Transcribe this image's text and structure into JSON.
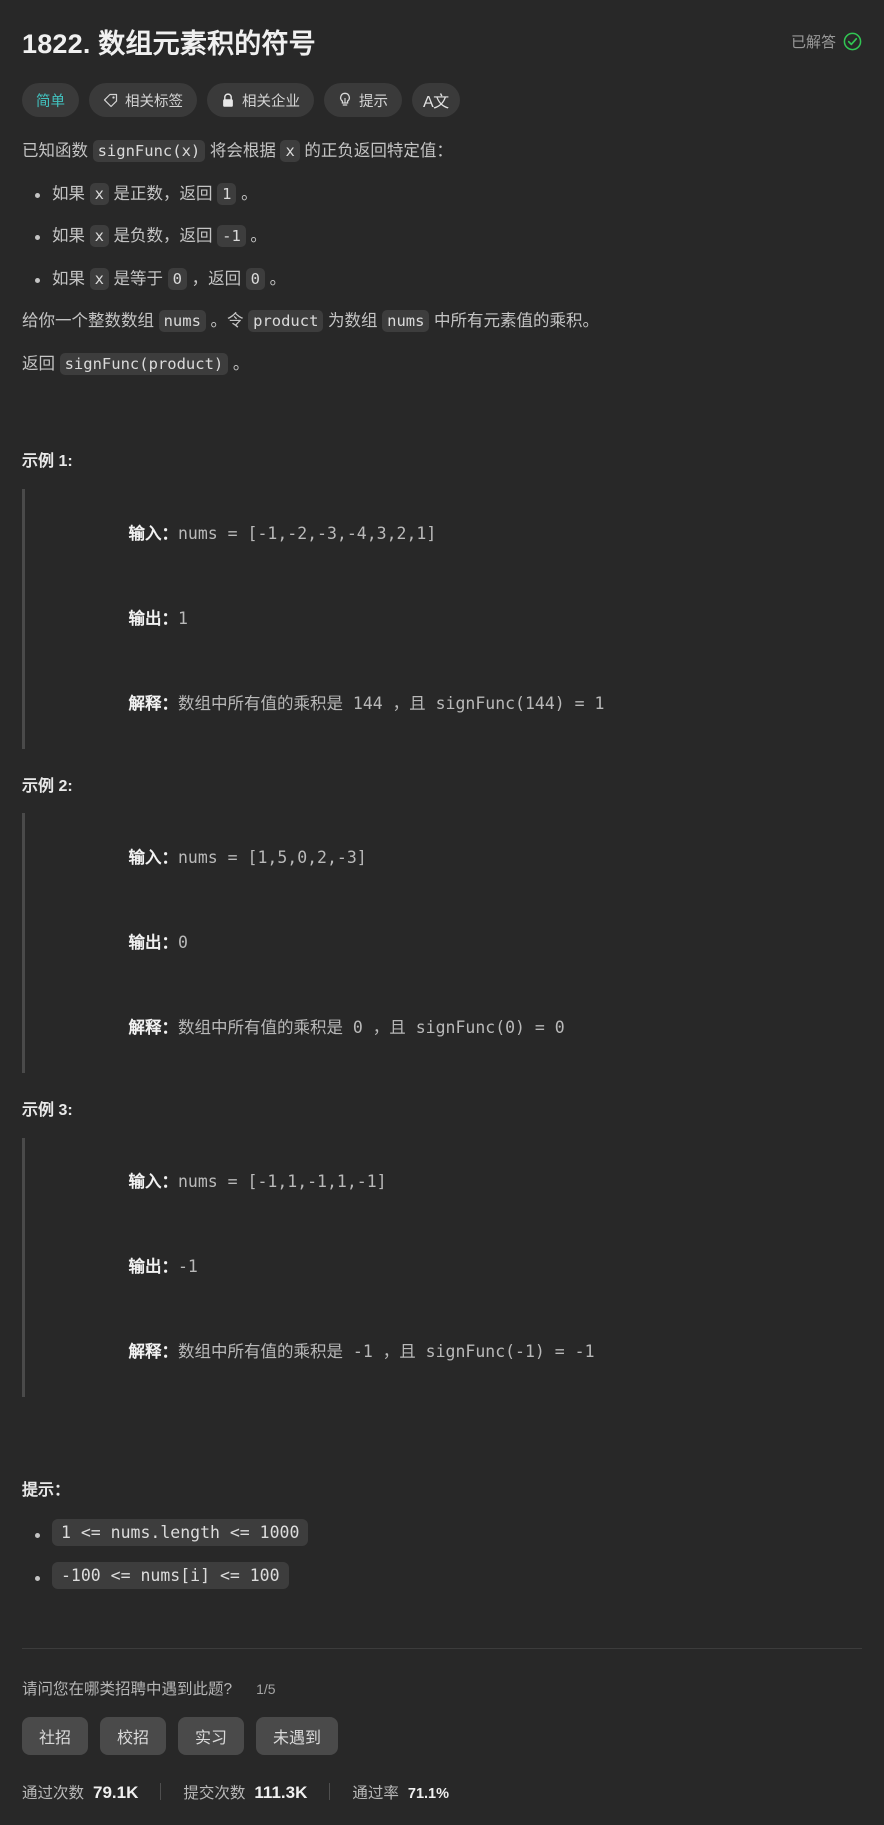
{
  "header": {
    "title": "1822. 数组元素积的符号",
    "solved_label": "已解答",
    "solved_color": "#31c653",
    "badges": [
      {
        "label": "简单",
        "icon": "",
        "accent": "#42c3c0"
      },
      {
        "label": "相关标签",
        "icon": "tag-icon"
      },
      {
        "label": "相关企业",
        "icon": "lock-icon"
      },
      {
        "label": "提示",
        "icon": "lightbulb-icon"
      },
      {
        "label": "A文",
        "icon": "translate-icon"
      }
    ]
  },
  "description": {
    "intro_1": "已知函数",
    "intro_code_1": "signFunc(x)",
    "intro_2": "将会根据",
    "intro_code_2": "x",
    "intro_3": "的正负返回特定值：",
    "rules": [
      {
        "t1": "如果",
        "c1": "x",
        "t2": "是正数，返回",
        "c2": "1",
        "t3": "。"
      },
      {
        "t1": "如果",
        "c1": "x",
        "t2": "是负数，返回",
        "c2": "-1",
        "t3": "。"
      },
      {
        "t1": "如果",
        "c1": "x",
        "t2": "是等于",
        "c2": "0",
        "t3": "，返回",
        "c3": "0",
        "t4": "。"
      }
    ],
    "para2_1": "给你一个整数数组",
    "para2_c1": "nums",
    "para2_2": "。令",
    "para2_c2": "product",
    "para2_3": "为数组",
    "para2_c3": "nums",
    "para2_4": "中所有元素值的乘积。",
    "para3_1": "返回",
    "para3_c1": "signFunc(product)",
    "para3_2": "。"
  },
  "examples": [
    {
      "title": "示例 1:",
      "input_label": "输入：",
      "input_value": "nums = [-1,-2,-3,-4,3,2,1]",
      "output_label": "输出：",
      "output_value": "1",
      "explain_label": "解释：",
      "explain_value": "数组中所有值的乘积是 144 ，且 signFunc(144) = 1"
    },
    {
      "title": "示例 2:",
      "input_label": "输入：",
      "input_value": "nums = [1,5,0,2,-3]",
      "output_label": "输出：",
      "output_value": "0",
      "explain_label": "解释：",
      "explain_value": "数组中所有值的乘积是 0 ，且 signFunc(0) = 0"
    },
    {
      "title": "示例 3:",
      "input_label": "输入：",
      "input_value": "nums = [-1,1,-1,1,-1]",
      "output_label": "输出：",
      "output_value": "-1",
      "explain_label": "解释：",
      "explain_value": "数组中所有值的乘积是 -1 ，且 signFunc(-1) = -1"
    }
  ],
  "constraints": {
    "title": "提示：",
    "items": [
      "1 <= nums.length <= 1000",
      "-100 <= nums[i] <= 100"
    ]
  },
  "survey": {
    "question": "请问您在哪类招聘中遇到此题?",
    "counter": "1/5",
    "options": [
      "社招",
      "校招",
      "实习",
      "未遇到"
    ]
  },
  "stats": [
    {
      "label": "通过次数",
      "value": "79.1K"
    },
    {
      "label": "提交次数",
      "value": "111.3K"
    },
    {
      "label": "通过率",
      "value": "71.1%"
    }
  ]
}
